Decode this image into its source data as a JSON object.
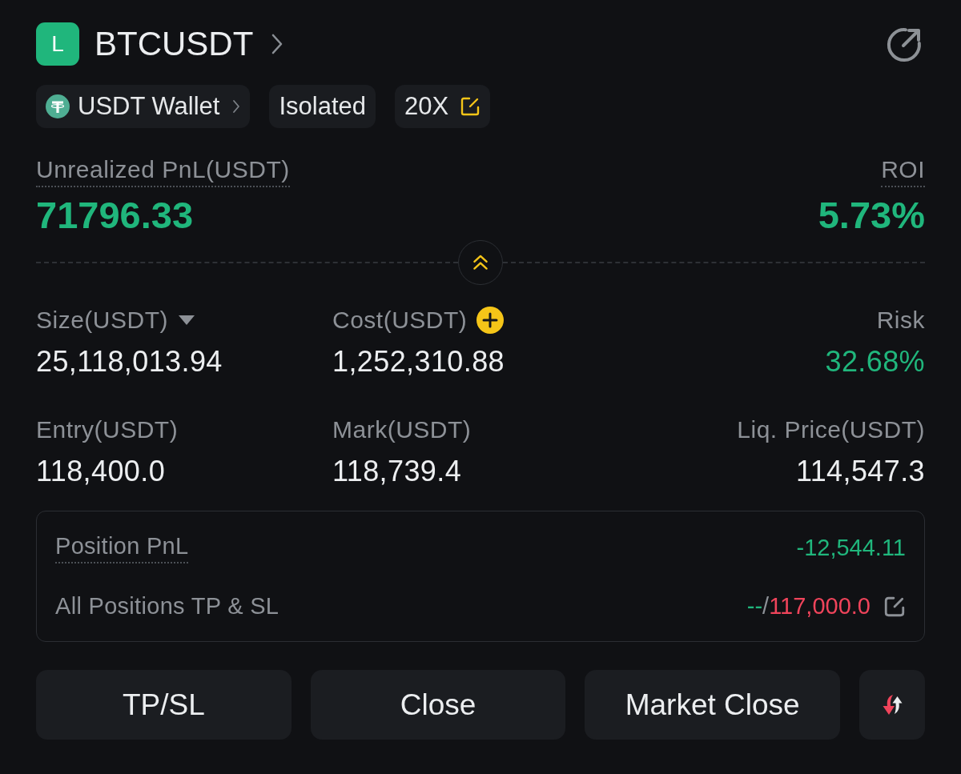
{
  "header": {
    "side_badge": "L",
    "color": "#20b67c",
    "symbol": "BTCUSDT"
  },
  "tags": [
    {
      "kind": "wallet",
      "label": "USDT Wallet"
    },
    {
      "kind": "margin",
      "label": "Isolated"
    },
    {
      "kind": "leverage",
      "label": "20X"
    }
  ],
  "pnl": {
    "label": "Unrealized PnL(USDT)",
    "value": "71796.33",
    "color": "#20b67c"
  },
  "roi": {
    "label": "ROI",
    "value": "5.73%",
    "color": "#20b67c"
  },
  "stats": [
    {
      "kind": "dropdown",
      "label": "Size(USDT)",
      "value": "25,118,013.94",
      "color": "#eceef0"
    },
    {
      "kind": "add",
      "label": "Cost(USDT)",
      "value": "1,252,310.88",
      "color": "#eceef0"
    },
    {
      "kind": "plain",
      "label": "Risk",
      "value": "32.68%",
      "color": "#20b67c"
    },
    {
      "kind": "plain",
      "label": "Entry(USDT)",
      "value": "118,400.0",
      "color": "#eceef0"
    },
    {
      "kind": "plain",
      "label": "Mark(USDT)",
      "value": "118,739.4",
      "color": "#eceef0"
    },
    {
      "kind": "plain",
      "label": "Liq. Price(USDT)",
      "value": "114,547.3",
      "color": "#eceef0"
    }
  ],
  "summary": [
    {
      "kind": "pnl",
      "label": "Position PnL",
      "value": "-12,544.11",
      "color": "#20b67c"
    },
    {
      "kind": "tpsl",
      "label": "All Positions TP & SL",
      "tp": "--",
      "separator": "/",
      "sl": "117,000.0"
    }
  ],
  "actions": [
    {
      "label": "TP/SL"
    },
    {
      "label": "Close"
    },
    {
      "label": "Market Close"
    }
  ]
}
